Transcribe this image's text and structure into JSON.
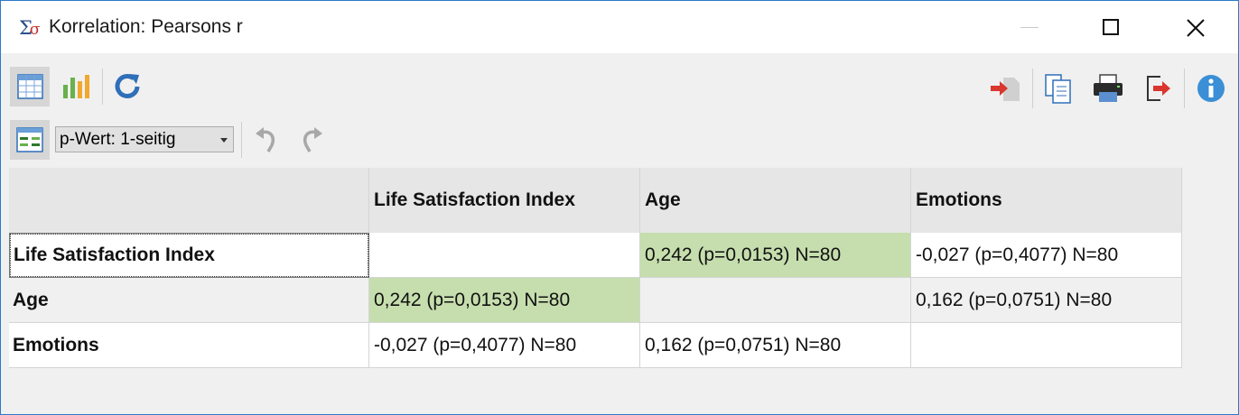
{
  "window": {
    "title": "Korrelation: Pearsons r",
    "app_icon": "sigma-icon"
  },
  "toolbar": {
    "left_buttons": [
      "table-view-icon",
      "chart-view-icon",
      "refresh-icon"
    ],
    "right_buttons": [
      "import-icon",
      "copy-icon",
      "print-icon",
      "export-icon",
      "info-icon"
    ]
  },
  "options": {
    "pvalue_select": "p-Wert: 1-seitig",
    "buttons": [
      "layout-icon",
      "undo-icon",
      "redo-icon"
    ]
  },
  "table": {
    "columns": [
      "",
      "Life Satisfaction Index",
      "Age",
      "Emotions"
    ],
    "rows": [
      {
        "label": "Life Satisfaction Index",
        "cells": [
          "",
          "0,242 (p=0,0153) N=80",
          "-0,027 (p=0,4077) N=80"
        ]
      },
      {
        "label": "Age",
        "cells": [
          "0,242 (p=0,0153) N=80",
          "",
          "0,162 (p=0,0751) N=80"
        ]
      },
      {
        "label": "Emotions",
        "cells": [
          "-0,027 (p=0,4077) N=80",
          "0,162 (p=0,0751) N=80",
          ""
        ]
      }
    ],
    "significant_color": "#c6deae"
  },
  "colors": {
    "accent": "#2b79c9",
    "arrow_red": "#d9362e",
    "info_blue": "#3a8fd6"
  }
}
